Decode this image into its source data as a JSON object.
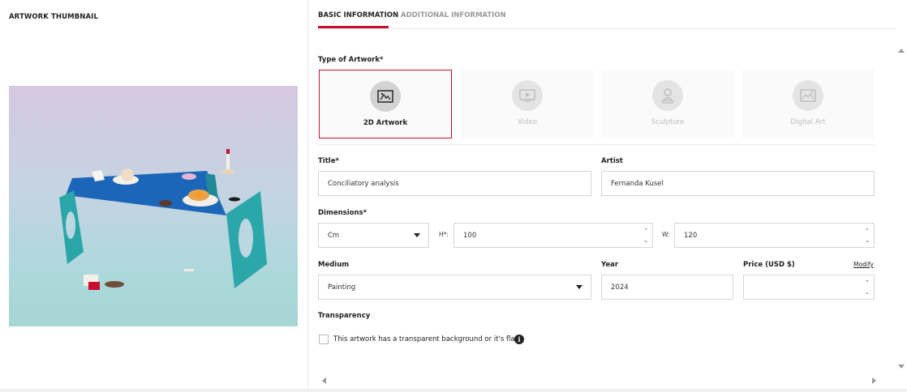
{
  "left_panel": {
    "title": "ARTWORK THUMBNAIL"
  },
  "tabs": [
    {
      "label": "BASIC INFORMATION",
      "active": true
    },
    {
      "label": "ADDITIONAL INFORMATION",
      "active": false
    }
  ],
  "colors": {
    "accent": "#c8102e",
    "border": "#d6d6d6"
  },
  "artwork_type": {
    "label": "Type of Artwork*",
    "selected": "2D Artwork",
    "options": [
      {
        "label": "2D Artwork",
        "icon": "painting-frame-icon"
      },
      {
        "label": "Video",
        "icon": "video-play-icon"
      },
      {
        "label": "Sculpture",
        "icon": "sculpture-bust-icon"
      },
      {
        "label": "Digital Art",
        "icon": "digital-image-icon"
      }
    ]
  },
  "title_field": {
    "label": "Title*",
    "value": "Conciliatory analysis"
  },
  "artist_field": {
    "label": "Artist",
    "value": "Fernanda Kusel"
  },
  "dimensions": {
    "label": "Dimensions*",
    "unit": "Cm",
    "height_label": "H*:",
    "height_value": "100",
    "width_label": "W:",
    "width_value": "120"
  },
  "medium": {
    "label": "Medium",
    "value": "Painting"
  },
  "year": {
    "label": "Year",
    "value": "2024"
  },
  "price": {
    "label": "Price (USD $)",
    "value": "",
    "modify_label": "Modify"
  },
  "transparency": {
    "label": "Transparency",
    "checkbox_label": "This artwork has a transparent background or it's flat",
    "checked": false,
    "info_icon": "info-icon"
  }
}
